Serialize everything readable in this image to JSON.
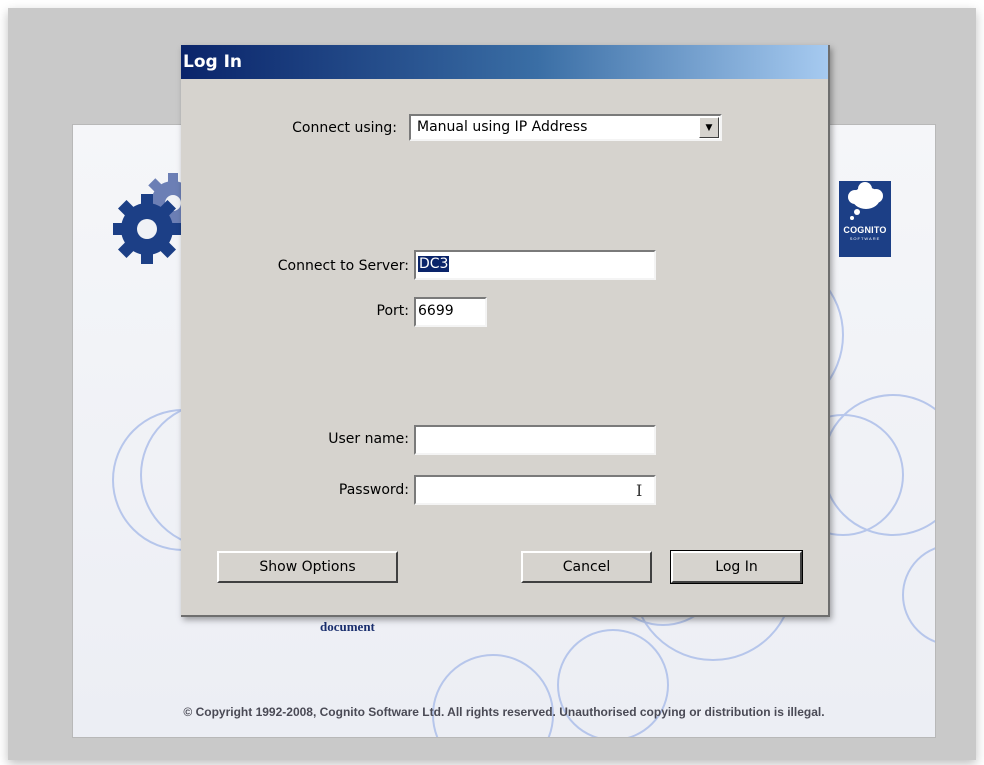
{
  "dialog": {
    "title": "Log In",
    "connect_using": {
      "label": "Connect using:",
      "value": "Manual using IP Address"
    },
    "server": {
      "label": "Connect to Server:",
      "value": "DC3"
    },
    "port": {
      "label": "Port:",
      "value": "6699"
    },
    "username": {
      "label": "User name:",
      "value": ""
    },
    "password": {
      "label": "Password:",
      "value": ""
    },
    "buttons": {
      "show_options": "Show Options",
      "cancel": "Cancel",
      "login": "Log In"
    }
  },
  "background": {
    "logo_text": "COGNITO",
    "logo_subtext": "SOFTWARE",
    "document_text": "document",
    "copyright": "© Copyright 1992-2008, Cognito Software Ltd. All rights reserved. Unauthorised copying or distribution is illegal.",
    "colors": {
      "gear": "#1c3f86",
      "gear_light": "#6c7fb5",
      "circles": "#9fb4e6"
    }
  }
}
